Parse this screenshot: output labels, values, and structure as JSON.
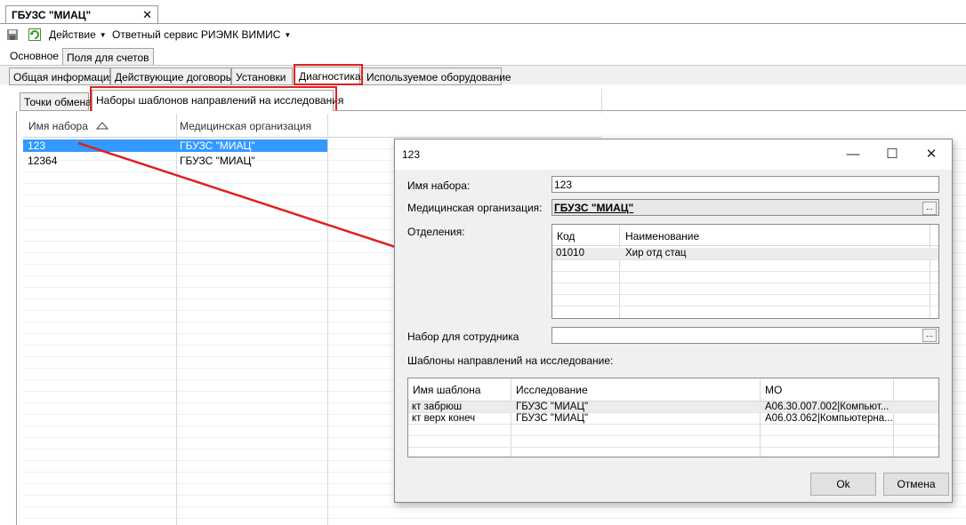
{
  "window_tab": {
    "title": "ГБУЗС \"МИАЦ\"",
    "close": "✕"
  },
  "toolbar": {
    "action_label": "Действие",
    "service_label": "Ответный сервис РИЭМК ВИМИС"
  },
  "subtabs_top": [
    "Основное",
    "Поля для счетов"
  ],
  "tabs": [
    "Общая информация",
    "Действующие договоры",
    "Установки",
    "Диагностика",
    "Используемое оборудование"
  ],
  "inner_tabs": [
    "Точки обмена",
    "Наборы шаблонов направлений на исследования"
  ],
  "grid": {
    "columns": [
      "Имя набора",
      "Медицинская организация"
    ],
    "rows": [
      {
        "name": "123",
        "org": "ГБУЗС \"МИАЦ\""
      },
      {
        "name": "12364",
        "org": "ГБУЗС \"МИАЦ\""
      }
    ]
  },
  "dialog": {
    "title": "123",
    "set_name_label": "Имя набора:",
    "set_name_value": "123",
    "org_label": "Медицинская организация:",
    "org_value": "ГБУЗС \"МИАЦ\"",
    "departments_label": "Отделения:",
    "departments": {
      "columns": [
        "Код",
        "Наименование"
      ],
      "rows": [
        {
          "code": "01010",
          "name": "Хир отд стац"
        }
      ]
    },
    "employee_label": "Набор для сотрудника",
    "templates_label": "Шаблоны направлений на исследование:",
    "templates": {
      "columns": [
        "Имя шаблона",
        "Исследование",
        "МО"
      ],
      "rows": [
        {
          "name": "кт забрюш",
          "study": "ГБУЗС \"МИАЦ\"",
          "mo": "А06.30.007.002|Компьют..."
        },
        {
          "name": "кт верх конеч",
          "study": "ГБУЗС \"МИАЦ\"",
          "mo": "А06.03.062|Компьютерна..."
        }
      ]
    },
    "ok_label": "Ok",
    "cancel_label": "Отмена",
    "ellipsis": "..."
  },
  "colors": {
    "selection": "#3399ff",
    "highlight": "#e02020"
  }
}
